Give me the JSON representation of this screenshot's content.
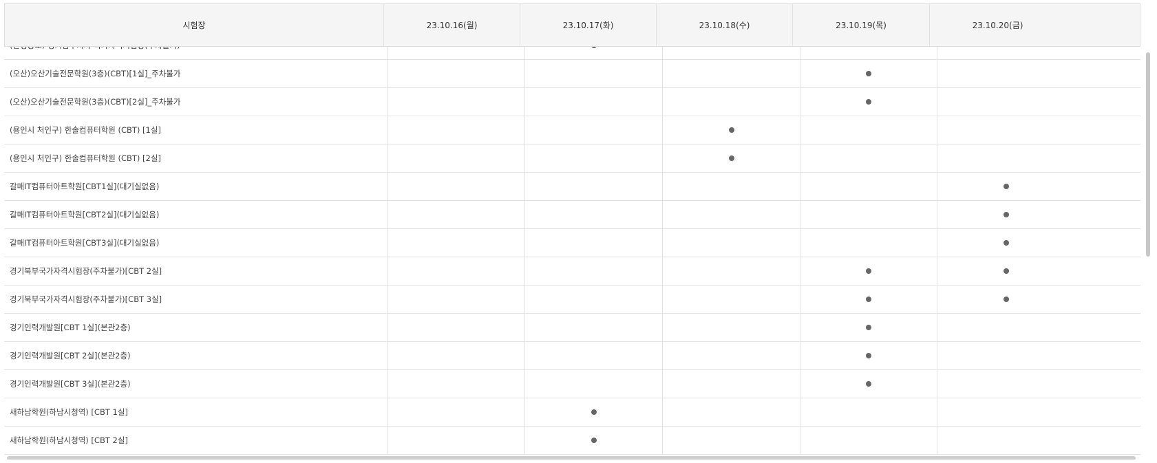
{
  "table": {
    "headers": [
      "시험장",
      "23.10.16(월)",
      "23.10.17(화)",
      "23.10.18(수)",
      "23.10.19(목)",
      "23.10.20(금)"
    ],
    "rows": [
      {
        "name": "(안성공도) 경기남부지사 국가자격시험장(주차불가)",
        "marks": [
          false,
          true,
          false,
          false,
          false
        ]
      },
      {
        "name": "(오산)오산기술전문학원(3층)(CBT)[1실]_주차불가",
        "marks": [
          false,
          false,
          false,
          true,
          false
        ]
      },
      {
        "name": "(오산)오산기술전문학원(3층)(CBT)[2실]_주차불가",
        "marks": [
          false,
          false,
          false,
          true,
          false
        ]
      },
      {
        "name": "(용인시 처인구) 한솔컴퓨터학원 (CBT) [1실]",
        "marks": [
          false,
          false,
          true,
          false,
          false
        ]
      },
      {
        "name": "(용인시 처인구) 한솔컴퓨터학원 (CBT) [2실]",
        "marks": [
          false,
          false,
          true,
          false,
          false
        ]
      },
      {
        "name": "갈매IT컴퓨터아트학원[CBT1실](대기실없음)",
        "marks": [
          false,
          false,
          false,
          false,
          true
        ]
      },
      {
        "name": "갈매IT컴퓨터아트학원[CBT2실](대기실없음)",
        "marks": [
          false,
          false,
          false,
          false,
          true
        ]
      },
      {
        "name": "갈매IT컴퓨터아트학원[CBT3실](대기실없음)",
        "marks": [
          false,
          false,
          false,
          false,
          true
        ]
      },
      {
        "name": "경기북부국가자격시험장(주차불가)[CBT 2실]",
        "marks": [
          false,
          false,
          false,
          true,
          true
        ]
      },
      {
        "name": "경기북부국가자격시험장(주차불가)[CBT 3실]",
        "marks": [
          false,
          false,
          false,
          true,
          true
        ]
      },
      {
        "name": "경기인력개발원[CBT 1실](본관2층)",
        "marks": [
          false,
          false,
          false,
          true,
          false
        ]
      },
      {
        "name": "경기인력개발원[CBT 2실](본관2층)",
        "marks": [
          false,
          false,
          false,
          true,
          false
        ]
      },
      {
        "name": "경기인력개발원[CBT 3실](본관2층)",
        "marks": [
          false,
          false,
          false,
          true,
          false
        ]
      },
      {
        "name": "새하남학원(하남시청역) [CBT 1실]",
        "marks": [
          false,
          true,
          false,
          false,
          false
        ]
      },
      {
        "name": "새하남학원(하남시청역) [CBT 2실]",
        "marks": [
          false,
          true,
          false,
          false,
          false
        ]
      }
    ]
  }
}
